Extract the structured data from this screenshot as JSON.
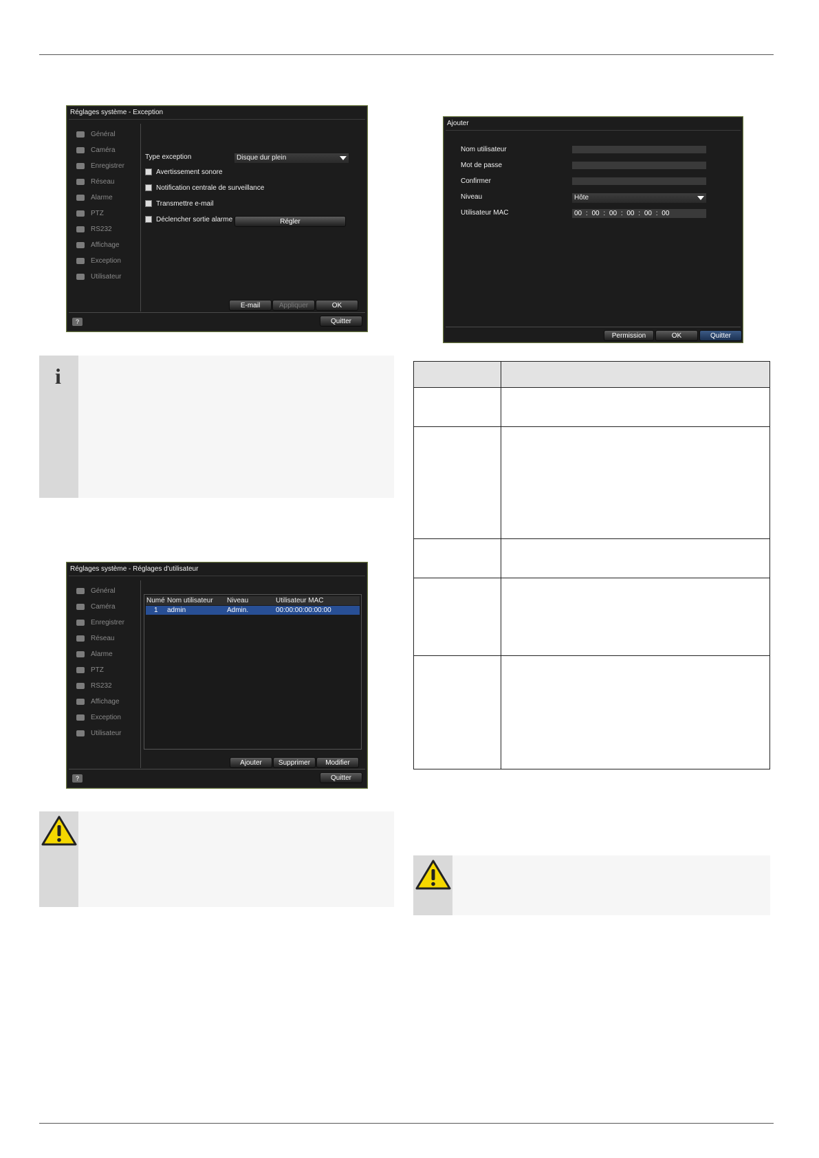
{
  "screen_exception": {
    "title": "Réglages système - Exception",
    "sidebar": [
      "Général",
      "Caméra",
      "Enregistrer",
      "Réseau",
      "Alarme",
      "PTZ",
      "RS232",
      "Affichage",
      "Exception",
      "Utilisateur"
    ],
    "type_label": "Type exception",
    "type_value": "Disque dur plein",
    "options": [
      "Avertissement sonore",
      "Notification centrale de surveillance",
      "Transmettre e-mail",
      "Déclencher sortie alarme"
    ],
    "regler_button": "Régler",
    "buttons": {
      "email": "E-mail",
      "apply": "Appliquer",
      "ok": "OK"
    },
    "help": "?",
    "quit": "Quitter"
  },
  "screen_users": {
    "title": "Réglages système - Réglages d'utilisateur",
    "sidebar": [
      "Général",
      "Caméra",
      "Enregistrer",
      "Réseau",
      "Alarme",
      "PTZ",
      "RS232",
      "Affichage",
      "Exception",
      "Utilisateur"
    ],
    "columns": [
      "Numé",
      "Nom utilisateur",
      "Niveau",
      "Utilisateur MAC"
    ],
    "rows": [
      {
        "num": "1",
        "name": "admin",
        "level": "Admin.",
        "mac": "00:00:00:00:00:00"
      }
    ],
    "buttons": {
      "add": "Ajouter",
      "delete": "Supprimer",
      "modify": "Modifier"
    },
    "help": "?",
    "quit": "Quitter"
  },
  "screen_add": {
    "title": "Ajouter",
    "labels": {
      "username": "Nom utilisateur",
      "password": "Mot de passe",
      "confirm": "Confirmer",
      "level": "Niveau",
      "mac": "Utilisateur MAC"
    },
    "level_value": "Hôte",
    "mac_value": "00 : 00 : 00 : 00 : 00 : 00",
    "buttons": {
      "permission": "Permission",
      "ok": "OK",
      "quit": "Quitter"
    }
  },
  "info_icon": "i"
}
